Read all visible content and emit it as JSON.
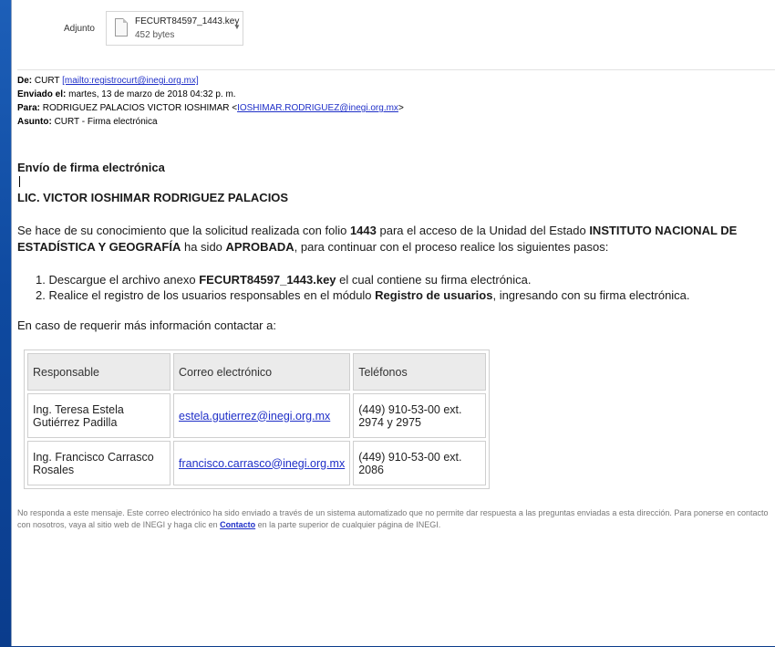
{
  "attachment": {
    "label": "Adjunto",
    "file_name": "FECURT84597_1443.key",
    "file_size": "452 bytes"
  },
  "headers": {
    "from_label": "De:",
    "from_name": "CURT",
    "from_link": "[mailto:registrocurt@inegi.org.mx]",
    "sent_label": "Enviado el:",
    "sent_value": "martes, 13 de marzo de 2018 04:32 p. m.",
    "to_label": "Para:",
    "to_name": "RODRIGUEZ PALACIOS VICTOR IOSHIMAR <",
    "to_email": "IOSHIMAR.RODRIGUEZ@inegi.org.mx",
    "to_close": ">",
    "subject_label": "Asunto:",
    "subject_value": "CURT - Firma electrónica"
  },
  "body": {
    "title": "Envío de firma electrónica",
    "recipient": "LIC. VICTOR IOSHIMAR RODRIGUEZ PALACIOS",
    "intro_1": "Se hace de su conocimiento que la solicitud realizada con folio ",
    "folio": "1443",
    "intro_2": " para el acceso de la Unidad del Estado ",
    "unidad": "INSTITUTO NACIONAL DE ESTADÍSTICA Y GEOGRAFÍA",
    "intro_3": " ha sido ",
    "status": "APROBADA",
    "intro_4": ", para continuar con el proceso realice los siguientes pasos:",
    "step1_a": "1.  Descargue el archivo anexo ",
    "step1_file": "FECURT84597_1443.key",
    "step1_b": " el cual contiene su firma electrónica.",
    "step2_a": "2.  Realice el registro de los usuarios responsables en el módulo ",
    "step2_module": "Registro de usuarios",
    "step2_b": ", ingresando con su firma electrónica.",
    "contact_intro": "En caso de requerir más información contactar a:"
  },
  "contacts": {
    "headers": [
      "Responsable",
      "Correo electrónico",
      "Teléfonos"
    ],
    "rows": [
      {
        "name": "Ing. Teresa Estela Gutiérrez Padilla",
        "email": "estela.gutierrez@inegi.org.mx",
        "phone": "(449) 910-53-00 ext. 2974 y 2975"
      },
      {
        "name": "Ing. Francisco Carrasco Rosales",
        "email": "francisco.carrasco@inegi.org.mx",
        "phone": "(449) 910-53-00 ext. 2086"
      }
    ]
  },
  "footer": {
    "text_1": "No responda a este mensaje. Este correo electrónico ha sido enviado a través de un sistema automatizado que no permite dar respuesta a las preguntas enviadas a esta dirección. Para ponerse en contacto con nosotros, vaya al sitio web de INEGI y haga clic en ",
    "link": "Contacto",
    "text_2": " en la parte superior de cualquier página de INEGI."
  },
  "colors": {
    "desktop_blue": "#1d5fb8",
    "link_blue": "#1f2fc8"
  }
}
